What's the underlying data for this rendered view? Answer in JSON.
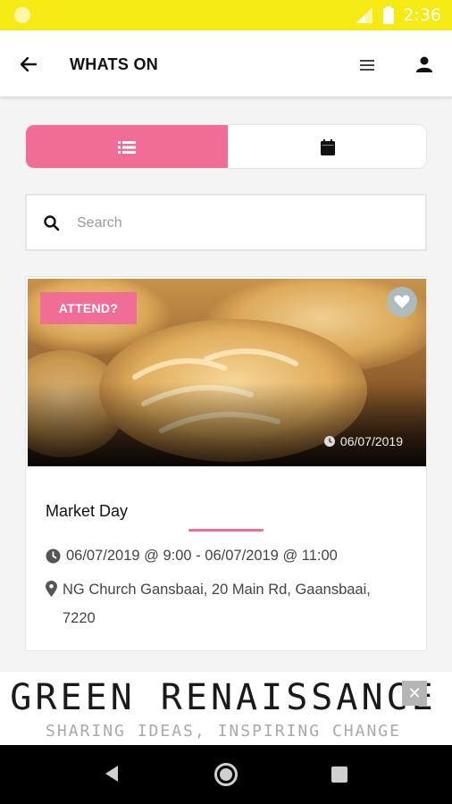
{
  "status_bar": {
    "time": "2:36"
  },
  "app_bar": {
    "title": "WHATS ON"
  },
  "search": {
    "placeholder": "Search"
  },
  "event": {
    "badge": "ATTEND?",
    "image_date": "06/07/2019",
    "title": "Market Day",
    "when": "06/07/2019 @ 9:00 - 06/07/2019 @ 11:00",
    "where": "NG Church Gansbaai, 20 Main Rd, Gaansbaai, 7220"
  },
  "ad": {
    "title": "GREEN RENAISSANCE",
    "tagline": "SHARING IDEAS, INSPIRING CHANGE",
    "close": "✕"
  },
  "colors": {
    "status_bar": "#f5ea13",
    "accent_pink": "#f06e95"
  },
  "icons": {
    "back": "arrow-left-icon",
    "menu": "menu-lines-icon",
    "profile": "person-icon",
    "list_view": "list-icon",
    "calendar_view": "calendar-icon",
    "search": "search-icon",
    "favorite": "heart-icon",
    "clock": "clock-icon",
    "location": "map-pin-icon"
  }
}
